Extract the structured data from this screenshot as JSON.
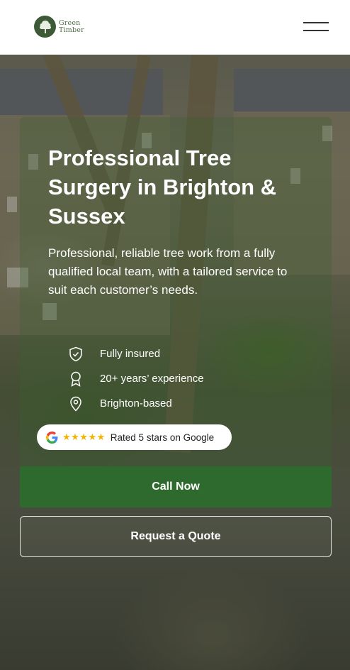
{
  "header": {
    "logo_line1": "Green",
    "logo_line2": "Timber"
  },
  "hero": {
    "title": "Professional Tree Surgery in Brighton & Sussex",
    "subtitle": "Professional, reliable tree work from a fully qualified local team, with a tailored service to suit each customer’s needs."
  },
  "features": [
    {
      "icon": "shield-check-icon",
      "label": "Fully insured"
    },
    {
      "icon": "award-ribbon-icon",
      "label": "20+ years’ experience"
    },
    {
      "icon": "location-pin-icon",
      "label": "Brighton-based"
    }
  ],
  "rating": {
    "icon": "google-icon",
    "stars": "★★★★★",
    "text": "Rated 5 stars on Google",
    "star_color": "#f0b400"
  },
  "cta": {
    "primary": "Call Now",
    "secondary": "Request a Quote",
    "primary_color": "#2e6a2e"
  }
}
